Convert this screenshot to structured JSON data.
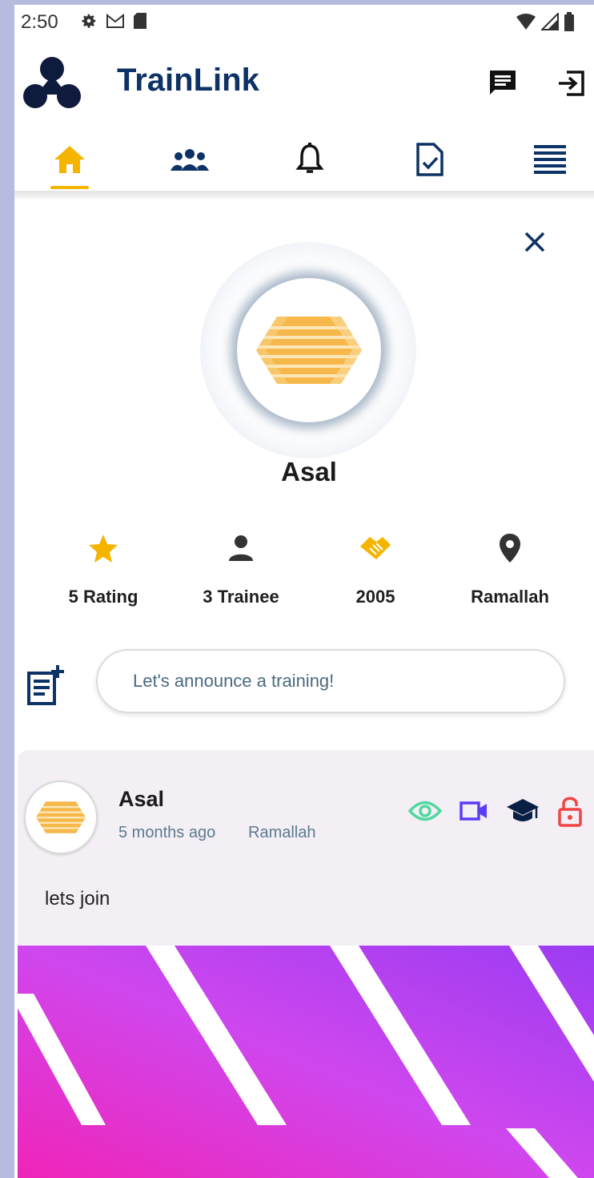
{
  "status_bar": {
    "time": "2:50"
  },
  "app": {
    "title": "TrainLink"
  },
  "nav": {
    "tabs": [
      {
        "icon": "home-icon",
        "active": true
      },
      {
        "icon": "people-icon",
        "active": false
      },
      {
        "icon": "bell-icon",
        "active": false
      },
      {
        "icon": "document-check-icon",
        "active": false
      },
      {
        "icon": "menu-lines-icon",
        "active": false
      }
    ],
    "active_color": "#f5b400"
  },
  "profile": {
    "name": "Asal",
    "stats": [
      {
        "icon": "star-icon",
        "label": "5 Rating"
      },
      {
        "icon": "person-icon",
        "label": "3 Trainee"
      },
      {
        "icon": "handshake-icon",
        "label": "2005"
      },
      {
        "icon": "location-pin-icon",
        "label": "Ramallah"
      }
    ]
  },
  "announce": {
    "placeholder": "Let's announce a training!"
  },
  "post": {
    "author": "Asal",
    "time_ago": "5 months ago",
    "location": "Ramallah",
    "text": "lets join",
    "action_icons": [
      "eye-icon",
      "video-icon",
      "graduation-cap-icon",
      "lock-icon"
    ]
  },
  "colors": {
    "brand": "#0d3266",
    "accent": "#f5b400",
    "eye": "#4fd8a0",
    "video": "#5b3df5",
    "cap": "#0a1f44",
    "lock": "#f04545"
  }
}
